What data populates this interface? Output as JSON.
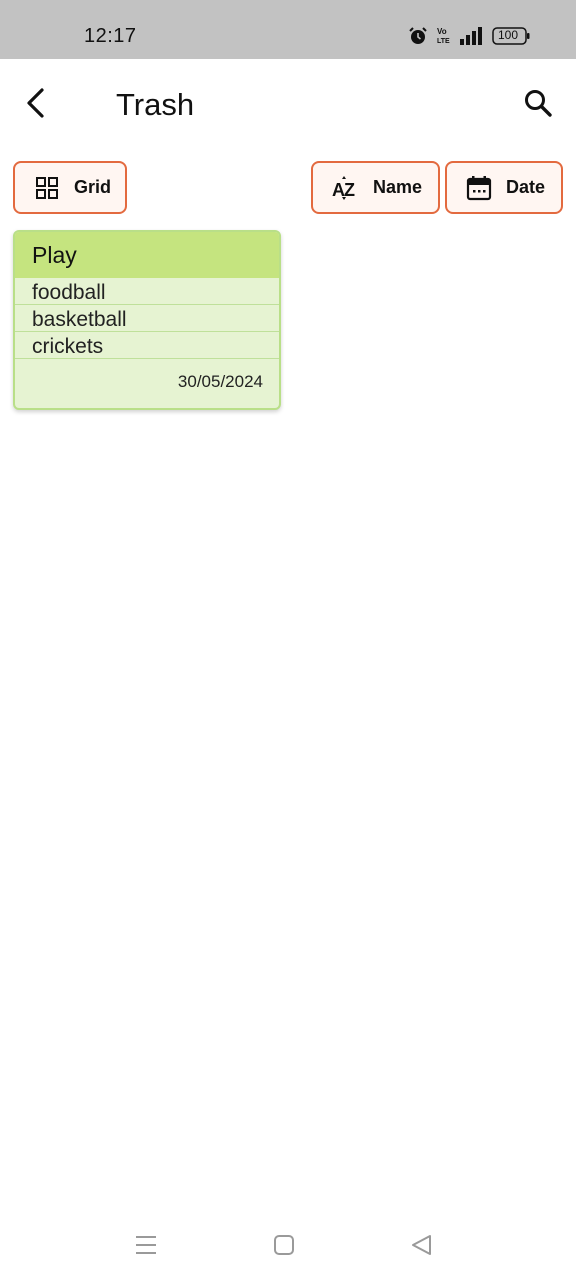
{
  "status_bar": {
    "time": "12:17",
    "battery": "100",
    "icons": [
      "alarm-icon",
      "volte-icon",
      "signal-icon",
      "battery-icon"
    ]
  },
  "app_bar": {
    "title": "Trash",
    "back_icon": "chevron-left-icon",
    "search_icon": "search-icon"
  },
  "toolbar": {
    "view_label": "Grid",
    "sort_name_label": "Name",
    "sort_date_label": "Date",
    "accent_color": "#e36a3f"
  },
  "notes": [
    {
      "title": "Play",
      "items": [
        "foodball",
        "basketball",
        "crickets"
      ],
      "date": "30/05/2024",
      "header_color": "#c5e47f",
      "body_color": "#e6f3d2"
    }
  ],
  "nav_bar": {
    "icons": [
      "menu-icon",
      "home-icon",
      "back-triangle-icon"
    ]
  }
}
